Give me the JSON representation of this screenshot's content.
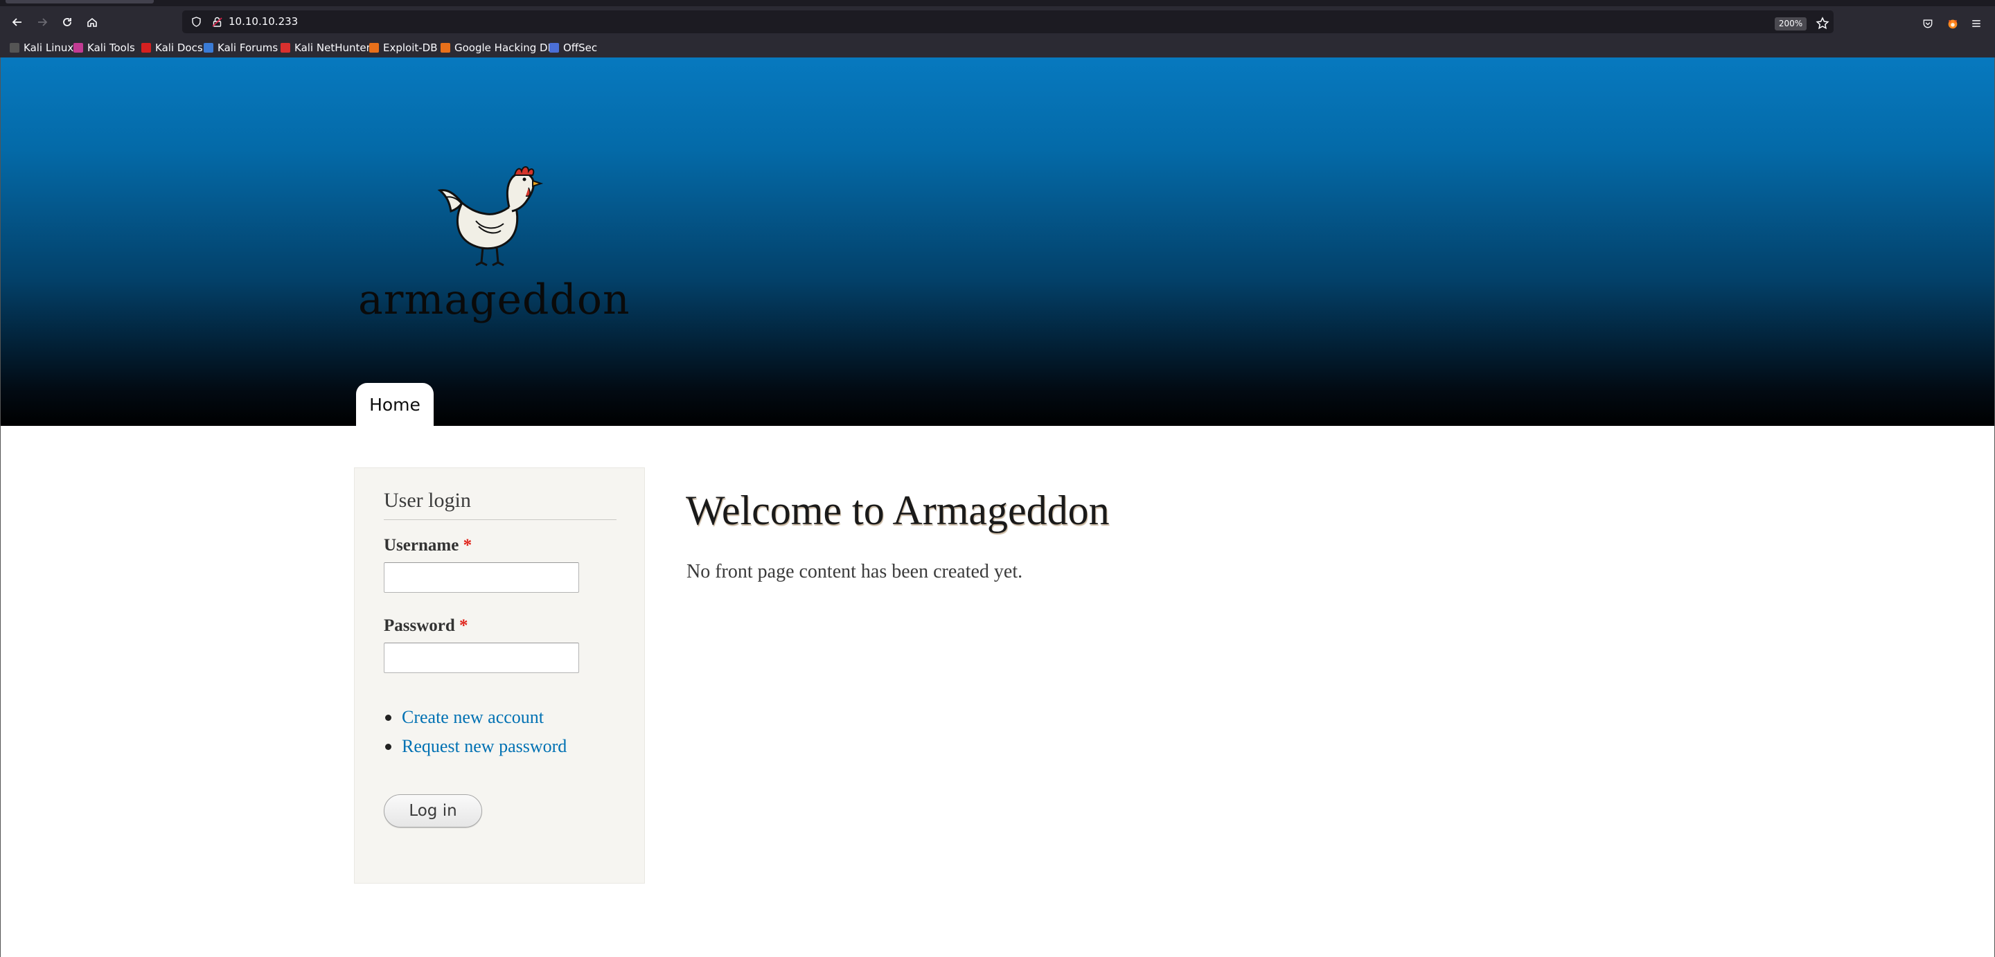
{
  "browser": {
    "url": "10.10.10.233",
    "zoom": "200%",
    "bookmarks": [
      {
        "label": "Kali Linux",
        "icon": "kali-dragon-icon",
        "color": "#555555"
      },
      {
        "label": "Kali Tools",
        "icon": "kali-tools-icon",
        "color": "#c23b93"
      },
      {
        "label": "Kali Docs",
        "icon": "kali-docs-icon",
        "color": "#d42020"
      },
      {
        "label": "Kali Forums",
        "icon": "kali-forums-icon",
        "color": "#3a7bd5"
      },
      {
        "label": "Kali NetHunter",
        "icon": "kali-nethunter-icon",
        "color": "#d9302e"
      },
      {
        "label": "Exploit-DB",
        "icon": "exploit-db-icon",
        "color": "#e8701a"
      },
      {
        "label": "Google Hacking DB",
        "icon": "ghdb-icon",
        "color": "#e8701a"
      },
      {
        "label": "OffSec",
        "icon": "offsec-icon",
        "color": "#4b6fd6"
      }
    ]
  },
  "site": {
    "logo_text": "armageddon",
    "nav": {
      "home": "Home"
    }
  },
  "login": {
    "title": "User login",
    "username_label": "Username",
    "password_label": "Password",
    "required_mark": "*",
    "create_account": "Create new account",
    "request_password": "Request new password",
    "submit": "Log in"
  },
  "main": {
    "title": "Welcome to Armageddon",
    "text": "No front page content has been created yet."
  },
  "colors": {
    "header_top": "#0779bf",
    "header_bottom": "#000000",
    "link": "#0071b3",
    "required": "#e0241b",
    "sidebar_bg": "#f6f5f1"
  }
}
